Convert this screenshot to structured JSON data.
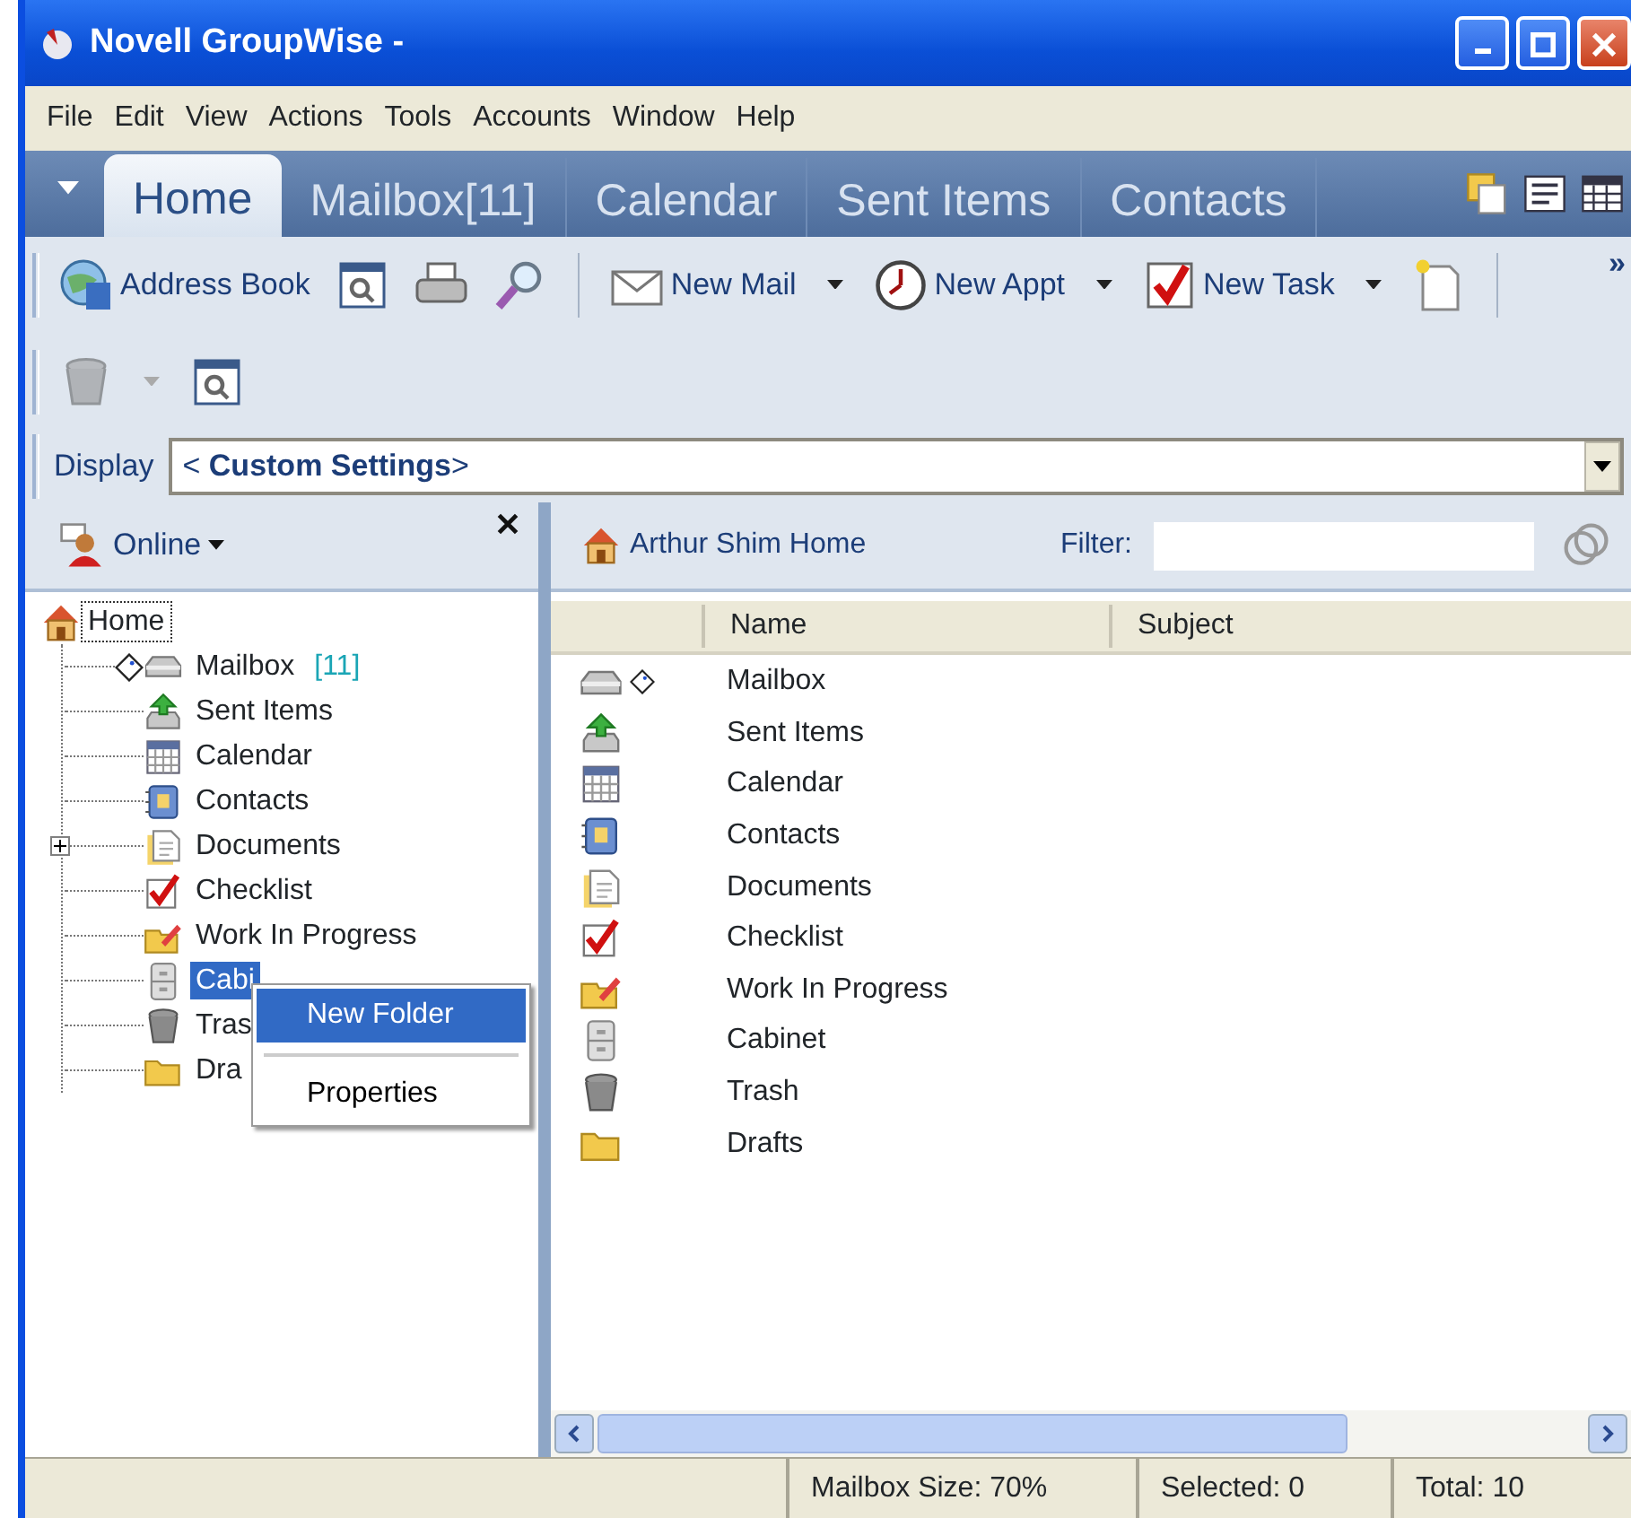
{
  "window": {
    "title": "Novell GroupWise -"
  },
  "menu": [
    "File",
    "Edit",
    "View",
    "Actions",
    "Tools",
    "Accounts",
    "Window",
    "Help"
  ],
  "tabs": [
    {
      "label": "Home",
      "selected": true
    },
    {
      "label": "Mailbox[11]",
      "selected": false
    },
    {
      "label": "Calendar",
      "selected": false
    },
    {
      "label": "Sent Items",
      "selected": false
    },
    {
      "label": "Contacts",
      "selected": false
    }
  ],
  "toolbar": [
    {
      "kind": "addressbook",
      "label": "Address Book"
    },
    {
      "kind": "find"
    },
    {
      "kind": "print"
    },
    {
      "kind": "search"
    },
    {
      "kind": "sep"
    },
    {
      "kind": "mail",
      "label": "New Mail",
      "dropdown": true
    },
    {
      "kind": "appt",
      "label": "New Appt",
      "dropdown": true
    },
    {
      "kind": "task",
      "label": "New Task",
      "dropdown": true
    },
    {
      "kind": "doc"
    },
    {
      "kind": "sep"
    },
    {
      "kind": "more",
      "label": "»"
    }
  ],
  "toolbar2": [
    {
      "kind": "trash",
      "disabled": true,
      "dropdown": true
    },
    {
      "kind": "find",
      "disabled": false
    }
  ],
  "display": {
    "label": "Display",
    "value": "< **Custom Settings**>"
  },
  "left_pane": {
    "status": "Online",
    "tree": {
      "label": "Home",
      "kind": "home",
      "focused": true,
      "selected": false,
      "children": [
        {
          "label": "Mailbox",
          "count": "[11]",
          "kind": "mailbox",
          "selected": false,
          "collapsed": false
        },
        {
          "label": "Sent Items",
          "kind": "sent",
          "selected": false,
          "collapsed": false
        },
        {
          "label": "Calendar",
          "kind": "calendar",
          "selected": false,
          "collapsed": false
        },
        {
          "label": "Contacts",
          "kind": "contacts",
          "selected": false,
          "collapsed": false
        },
        {
          "label": "Documents",
          "kind": "documents",
          "selected": false,
          "collapsed": true
        },
        {
          "label": "Checklist",
          "kind": "checklist",
          "selected": false,
          "collapsed": false
        },
        {
          "label": "Work In Progress",
          "kind": "wip",
          "selected": false,
          "collapsed": false
        },
        {
          "label": "Cabi",
          "kind": "cabinet",
          "selected": true,
          "collapsed": false
        },
        {
          "label": "Tras",
          "kind": "trash",
          "selected": false,
          "collapsed": false
        },
        {
          "label": "Dra",
          "kind": "drafts",
          "selected": false,
          "collapsed": false
        }
      ]
    }
  },
  "context_menu": [
    {
      "label": "New Folder",
      "selected": true
    },
    {
      "label": "Properties",
      "selected": false
    }
  ],
  "right_pane": {
    "location": "Arthur Shim Home",
    "filter_label": "Filter:",
    "columns": [
      "Name",
      "Subject"
    ],
    "rows": [
      {
        "name": "Mailbox",
        "kind": "mailbox"
      },
      {
        "name": "Sent Items",
        "kind": "sent"
      },
      {
        "name": "Calendar",
        "kind": "calendar"
      },
      {
        "name": "Contacts",
        "kind": "contacts"
      },
      {
        "name": "Documents",
        "kind": "documents"
      },
      {
        "name": "Checklist",
        "kind": "checklist"
      },
      {
        "name": "Work In Progress",
        "kind": "wip"
      },
      {
        "name": "Cabinet",
        "kind": "cabinet"
      },
      {
        "name": "Trash",
        "kind": "trash"
      },
      {
        "name": "Drafts",
        "kind": "drafts"
      }
    ]
  },
  "status_bar": [
    "Mailbox Size: 70%",
    "Selected: 0",
    "Total: 10"
  ]
}
